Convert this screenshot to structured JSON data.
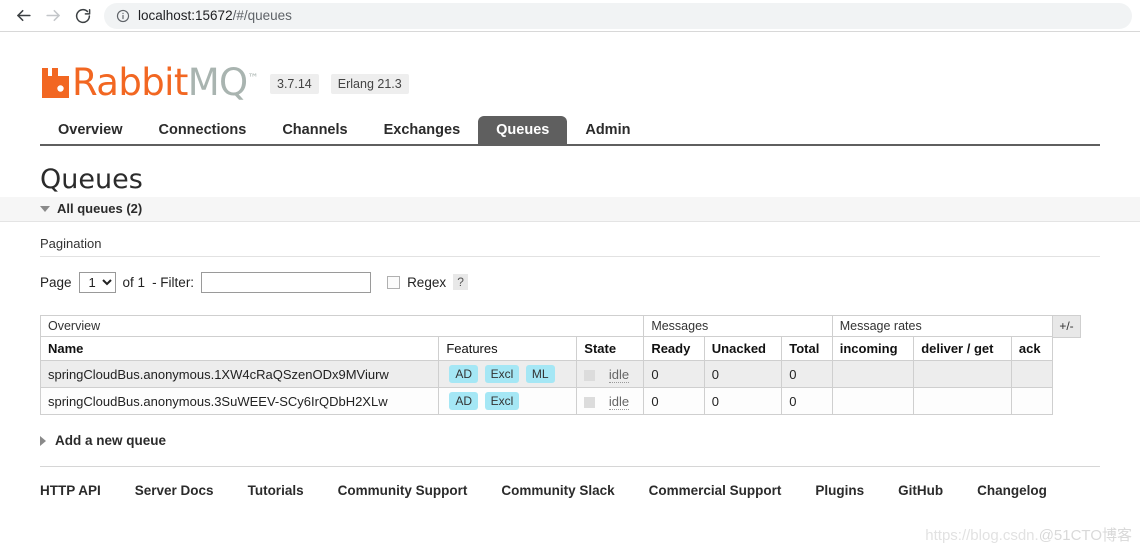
{
  "browser": {
    "url_host": "localhost:15672",
    "url_path": "/#/queues",
    "back_icon": "back-arrow-icon",
    "forward_icon": "forward-arrow-icon",
    "reload_icon": "reload-icon",
    "info_icon": "info-circle-icon"
  },
  "brand": {
    "name_primary": "Rabbit",
    "name_secondary": "MQ",
    "trademark": "™",
    "version": "3.7.14",
    "erlang": "Erlang 21.3",
    "color_orange": "#f26722",
    "color_grey": "#a9b4b0"
  },
  "nav": {
    "tabs": [
      {
        "label": "Overview",
        "active": false
      },
      {
        "label": "Connections",
        "active": false
      },
      {
        "label": "Channels",
        "active": false
      },
      {
        "label": "Exchanges",
        "active": false
      },
      {
        "label": "Queues",
        "active": true
      },
      {
        "label": "Admin",
        "active": false
      }
    ]
  },
  "page": {
    "title": "Queues",
    "all_queues_label": "All queues (2)"
  },
  "pagination": {
    "section_label": "Pagination",
    "page_label": "Page",
    "page_value": "1",
    "page_options": [
      "1"
    ],
    "of_label": "of 1",
    "filter_label": "- Filter:",
    "filter_value": "",
    "filter_placeholder": "",
    "regex_label": "Regex",
    "regex_checked": false,
    "help_label": "?"
  },
  "table": {
    "group_headers": [
      {
        "label": "Overview",
        "span": 3
      },
      {
        "label": "Messages",
        "span": 3
      },
      {
        "label": "Message rates",
        "span": 3
      }
    ],
    "columns": [
      {
        "label": "Name",
        "bold": true
      },
      {
        "label": "Features",
        "bold": false
      },
      {
        "label": "State",
        "bold": true
      },
      {
        "label": "Ready",
        "bold": true
      },
      {
        "label": "Unacked",
        "bold": true
      },
      {
        "label": "Total",
        "bold": true
      },
      {
        "label": "incoming",
        "bold": true
      },
      {
        "label": "deliver / get",
        "bold": true
      },
      {
        "label": "ack",
        "bold": true
      }
    ],
    "toggle_columns_label": "+/-",
    "rows": [
      {
        "name": "springCloudBus.anonymous.1XW4cRaQSzenODx9MViurw",
        "features": [
          "AD",
          "Excl",
          "ML"
        ],
        "state": "idle",
        "ready": "0",
        "unacked": "0",
        "total": "0",
        "incoming": "",
        "deliver_get": "",
        "ack": ""
      },
      {
        "name": "springCloudBus.anonymous.3SuWEEV-SCy6IrQDbH2XLw",
        "features": [
          "AD",
          "Excl"
        ],
        "state": "idle",
        "ready": "0",
        "unacked": "0",
        "total": "0",
        "incoming": "",
        "deliver_get": "",
        "ack": ""
      }
    ]
  },
  "add_queue": {
    "label": "Add a new queue"
  },
  "footer": {
    "links": [
      "HTTP API",
      "Server Docs",
      "Tutorials",
      "Community Support",
      "Community Slack",
      "Commercial Support",
      "Plugins",
      "GitHub",
      "Changelog"
    ]
  },
  "watermark": {
    "text_a": "https://blog.csdn.",
    "text_b": "@51CTO博客"
  }
}
